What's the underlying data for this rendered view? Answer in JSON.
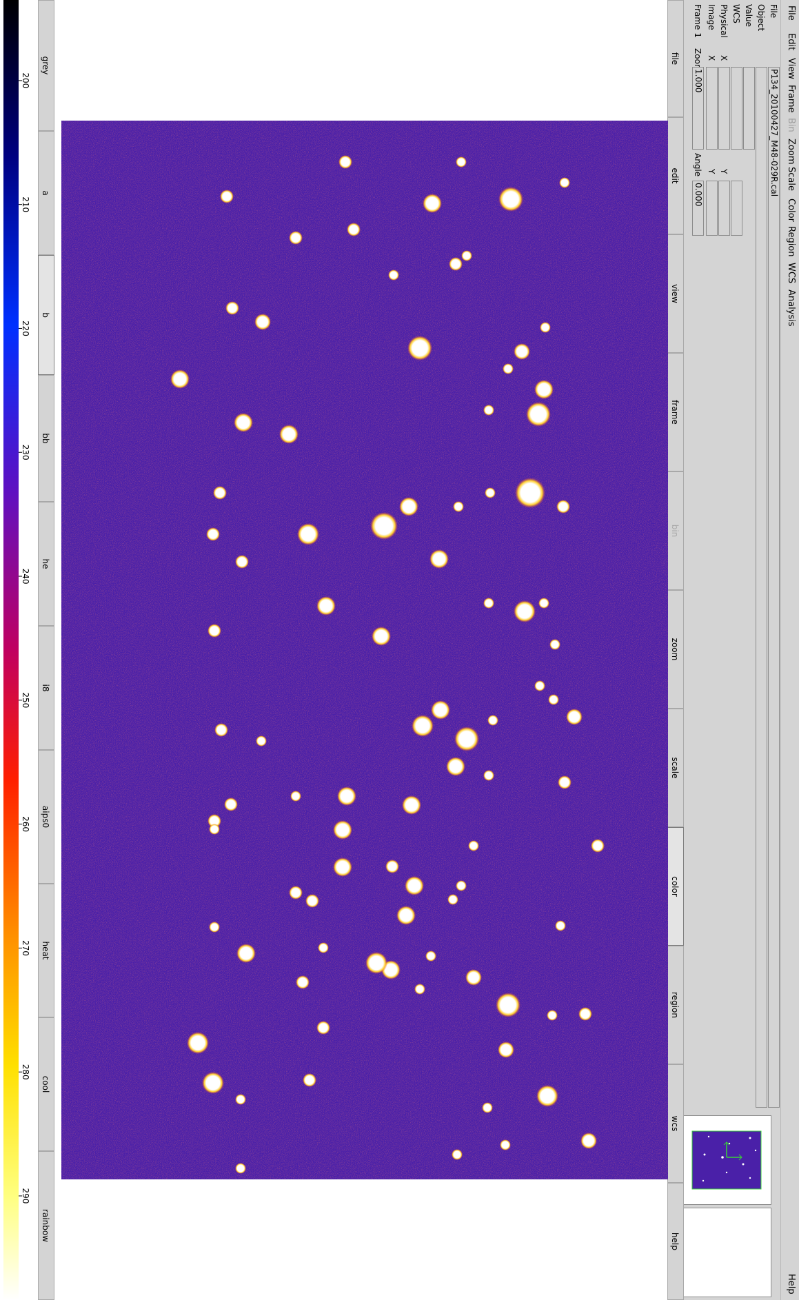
{
  "menu": [
    "File",
    "Edit",
    "View",
    "Frame",
    "Bin",
    "Zoom",
    "Scale",
    "Color",
    "Region",
    "WCS",
    "Analysis",
    "Help"
  ],
  "menu_disabled": [
    "Bin"
  ],
  "info": {
    "file_label": "File",
    "file_value": "P134_20100427_M48-029R.cal",
    "object_label": "Object",
    "value_label": "Value",
    "wcs_label": "WCS",
    "physical_label": "Physical",
    "image_label": "Image",
    "frame_label": "Frame 1",
    "x_label": "X",
    "y_label": "Y",
    "zoom_label": "Zoom",
    "zoom_value": "1.000",
    "angle_label": "Angle",
    "angle_value": "0.000"
  },
  "buttonbar": [
    "file",
    "edit",
    "view",
    "frame",
    "bin",
    "zoom",
    "scale",
    "color",
    "region",
    "wcs",
    "help"
  ],
  "buttonbar_selected": "color",
  "buttonbar_disabled": [
    "bin"
  ],
  "colorbuttons": [
    "grey",
    "a",
    "b",
    "bb",
    "he",
    "i8",
    "aips0",
    "heat",
    "cool",
    "rainbow"
  ],
  "colorbuttons_selected": "b",
  "colorbar": {
    "ticks": [
      "200",
      "210",
      "220",
      "230",
      "240",
      "250",
      "260",
      "270",
      "280",
      "290"
    ],
    "min": 193.5,
    "max": 298.4
  },
  "colors": {
    "background": "#4a20a8",
    "star": "#ffffff",
    "panel": "#d4d4d4"
  }
}
